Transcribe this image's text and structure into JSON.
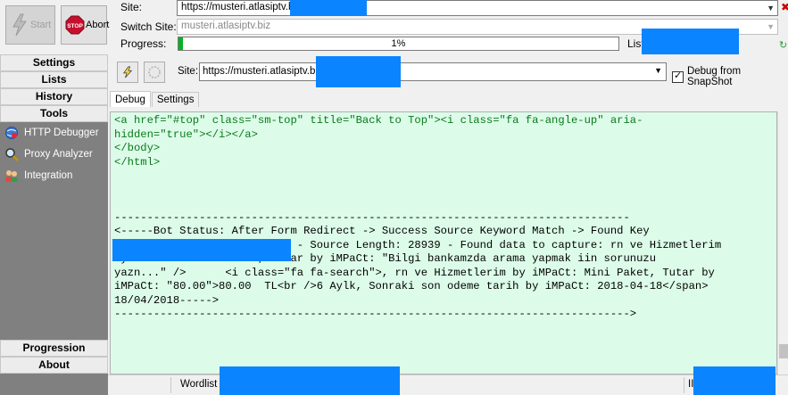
{
  "top": {
    "start_label": "Start",
    "abort_label": "Abort",
    "stop_sign_text": "STOP",
    "site_label": "Site:",
    "site_value": "https://musteri.atlasiptv.bi",
    "switch_label": "Switch Site:",
    "switch_value": "musteri.atlasiptv.biz",
    "progress_label": "Progress:",
    "progress_text": "1%",
    "progress_fraction": 0.01,
    "list_label": "List"
  },
  "nav": {
    "settings": "Settings",
    "lists": "Lists",
    "history": "History",
    "tools": "Tools",
    "items": [
      {
        "label": "HTTP Debugger",
        "icon": "globe-icon"
      },
      {
        "label": "Proxy Analyzer",
        "icon": "magnifier-icon"
      },
      {
        "label": "Integration",
        "icon": "users-icon"
      }
    ],
    "progression": "Progression",
    "about": "About"
  },
  "main": {
    "site_label": "Site:",
    "site_value": "https://musteri.atlasiptv.biz",
    "debug_checkbox_label": "Debug from SnapShot",
    "debug_checked": true,
    "tabs": [
      "Debug",
      "Settings"
    ],
    "code_lines": [
      {
        "text": "<a href=\"#top\" class=\"sm-top\" title=\"Back to Top\"><i class=\"fa fa-angle-up\" aria-",
        "color": "green"
      },
      {
        "text": "hidden=\"true\"></i></a>",
        "color": "green"
      },
      {
        "text": "</body>",
        "color": "green"
      },
      {
        "text": "</html>",
        "color": "green"
      },
      {
        "text": "",
        "color": "green"
      },
      {
        "text": "",
        "color": "green"
      },
      {
        "text": "",
        "color": "green"
      },
      {
        "text": "-------------------------------------------------------------------------------",
        "color": "black"
      },
      {
        "text": "<-----Bot Status: After Form Redirect -> Success Source Keyword Match -> Found Key",
        "color": "black"
      },
      {
        "text": "                            - Source Length: 28939 - Found data to capture: rn ve Hizmetlerim",
        "color": "black"
      },
      {
        "text": "by iMPaCt: hakan hakan, Tutar by iMPaCt: \"Bilgi bankamzda arama yapmak iin sorunuzu",
        "color": "black"
      },
      {
        "text": "yazn...\" />      <i class=\"fa fa-search\">, rn ve Hizmetlerim by iMPaCt: Mini Paket, Tutar by",
        "color": "black"
      },
      {
        "text": "iMPaCt: \"80.00\">80.00  TL<br />6 Aylk, Sonraki son odeme tarih by iMPaCt: 2018-04-18</span>",
        "color": "black"
      },
      {
        "text": "18/04/2018----->",
        "color": "black"
      },
      {
        "text": "------------------------------------------------------------------------------->",
        "color": "black"
      }
    ]
  },
  "status": {
    "wordlist_label": "Wordlist",
    "right_label": "II"
  },
  "colors": {
    "redaction": "#0a84ff",
    "code_bg": "#dcfce9",
    "code_green": "#0a7a1a",
    "nav_bg": "#808080",
    "progress_fill": "#06b025"
  }
}
